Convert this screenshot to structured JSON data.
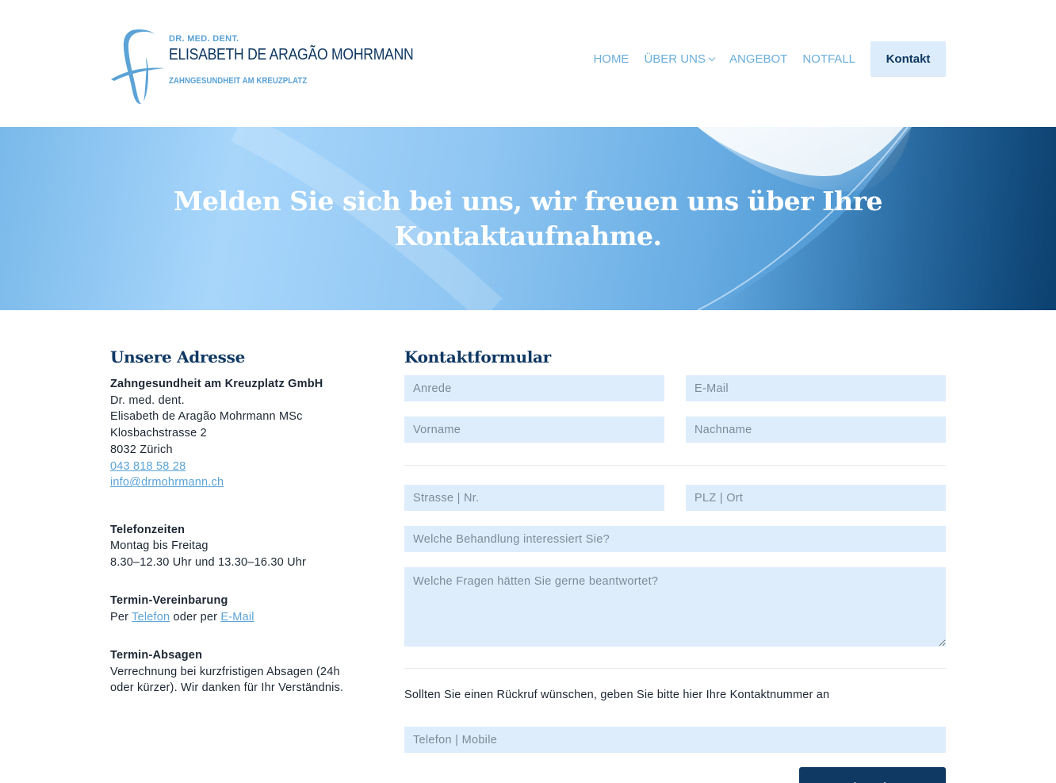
{
  "brand": {
    "pre": "DR. MED. DENT.",
    "name": "ELISABETH DE ARAGÃO MOHRMANN",
    "sub": "ZAHNGESUNDHEIT AM KREUZPLATZ",
    "icon": "tooth-logo-icon"
  },
  "nav": {
    "items": [
      "HOME",
      "ÜBER UNS",
      "ANGEBOT",
      "NOTFALL"
    ],
    "cta": "Kontakt"
  },
  "hero": {
    "line1": "Melden Sie sich bei uns, wir freuen uns über Ihre",
    "line2": "Kontaktaufnahme."
  },
  "address": {
    "title": "Unsere Adresse",
    "company": "Zahngesundheit am Kreuzplatz GmbH",
    "degree": "Dr. med. dent.",
    "person": "Elisabeth de Aragão Mohrmann MSc",
    "street": "Klosbachstrasse 2",
    "city": "8032 Zürich",
    "phone": "043 818 58 28",
    "email": "info@drmohrmann.ch"
  },
  "phone_hours": {
    "title": "Telefonzeiten",
    "days": "Montag bis Freitag",
    "times": "8.30–12.30 Uhr und 13.30–16.30 Uhr"
  },
  "appointment": {
    "title": "Termin-Vereinbarung",
    "prefix": "Per",
    "link1": "Telefon",
    "middle": "oder per",
    "link2": "E-Mail"
  },
  "cancellation": {
    "title": "Termin-Absagen",
    "line1": "Verrechnung bei kurzfristigen Absagen (24h",
    "line2": "oder kürzer). Wir danken für Ihr Verständnis."
  },
  "form": {
    "title": "Kontaktformular",
    "anrede": "Anrede",
    "email": "E-Mail",
    "vorname": "Vorname",
    "nachname": "Nachname",
    "strasse": "Strasse | Nr.",
    "plz": "PLZ | Ort",
    "behandlung": "Welche Behandlung interessiert Sie?",
    "fragen": "Welche Fragen hätten Sie gerne beantwortet?",
    "callback_note": "Sollten Sie einen Rückruf wünschen, geben Sie bitte hier Ihre Kontaktnummer an",
    "telefon": "Telefon | Mobile",
    "submit": "Absenden"
  },
  "colors": {
    "navy": "#0f3862",
    "light_blue": "#5ba3d7",
    "field_bg": "#deedfc"
  }
}
